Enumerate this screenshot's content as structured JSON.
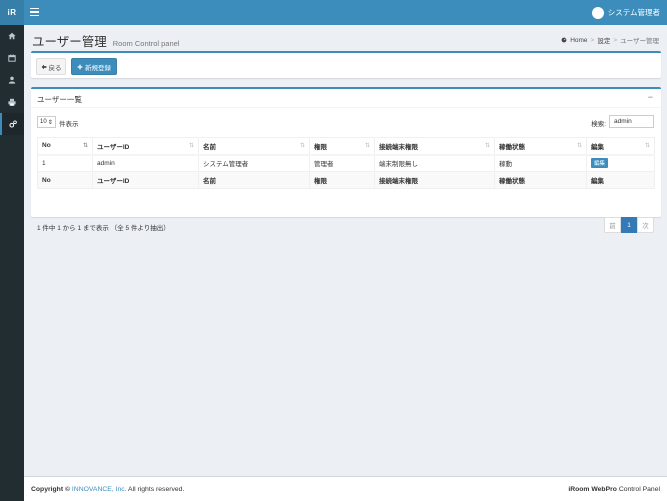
{
  "header": {
    "logo": "iR",
    "user_name": "システム管理者"
  },
  "sidebar": {
    "items": [
      {
        "icon": "home-icon"
      },
      {
        "icon": "calendar-icon"
      },
      {
        "icon": "user-icon"
      },
      {
        "icon": "print-icon"
      },
      {
        "icon": "settings-icon"
      }
    ]
  },
  "page": {
    "title": "ユーザー管理",
    "subtitle": "Room Control panel",
    "breadcrumb": {
      "home": "Home",
      "settings": "設定",
      "current": "ユーザー管理"
    }
  },
  "toolbar": {
    "back_label": "戻る",
    "new_label": "新規登録"
  },
  "list": {
    "title": "ユーザー一覧",
    "collapse": "−",
    "length_value": "10",
    "length_label": "件表示",
    "search_label": "検索:",
    "search_value": "admin",
    "columns": [
      "No",
      "ユーザーID",
      "名前",
      "権限",
      "接続端末権限",
      "稼働状態",
      "編集"
    ],
    "rows": [
      {
        "no": "1",
        "user_id": "admin",
        "name": "システム管理者",
        "role": "管理者",
        "terminal": "端末制限無し",
        "status": "稼動",
        "edit": "編集"
      }
    ],
    "info": "1 件中 1 から 1 まで表示 （全 5 件より抽出）",
    "pager": {
      "prev": "前",
      "current": "1",
      "next": "次"
    }
  },
  "footer": {
    "copyright_prefix": "Copyright ©",
    "company": "INNOVANCE, Inc.",
    "rights": "All rights reserved.",
    "product_bold": "iRoom WebPro",
    "product_rest": "Control Panel"
  },
  "colors": {
    "primary": "#3c8dbc",
    "sidebar": "#222d32",
    "background": "#ecf0f5"
  }
}
